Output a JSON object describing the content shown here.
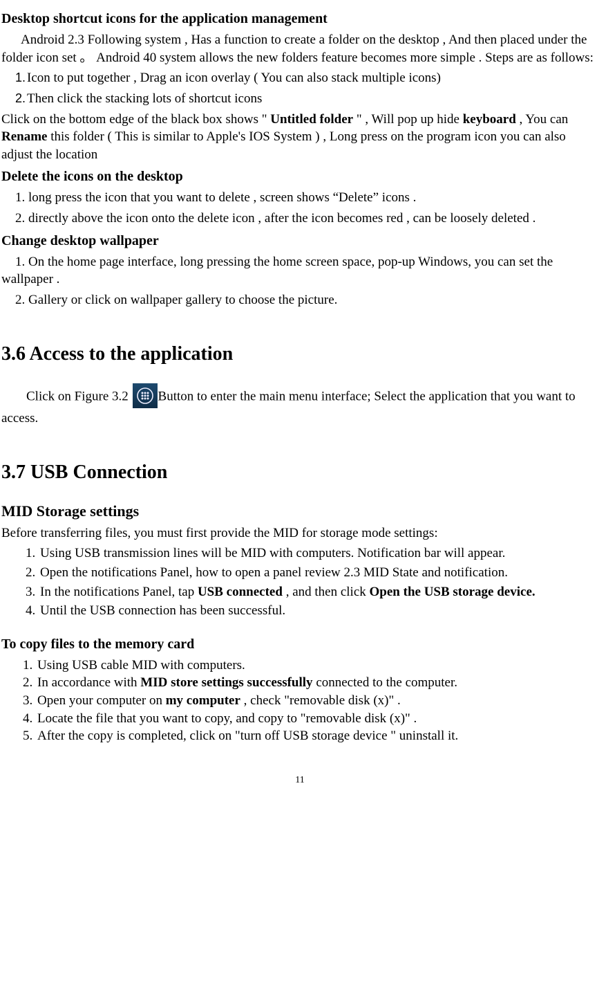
{
  "s1": {
    "title": "Desktop shortcut icons for the application management",
    "p1_a": "Android 2.3 Following system , Has a function to create a folder on the desktop , And then placed under the folder icon set  。  Android 40 system allows the new folders feature becomes more simple . Steps are as follows:",
    "li1_num": "1.",
    "li1": "Icon to put together , Drag an icon overlay ( You can also stack multiple icons)",
    "li2_num": "2.",
    "li2": "Then click the stacking lots of shortcut icons",
    "p2_a": "  Click on the bottom edge of the black box shows \" ",
    "p2_b": "Untitled folder",
    "p2_c": " \" , Will pop up hide ",
    "p2_d": "keyboard",
    "p2_e": " , You can ",
    "p2_f": "Rename",
    "p2_g": " this folder ( This is similar to Apple's IOS System ) , Long press on the program icon you can also adjust the location"
  },
  "s2": {
    "title": "Delete the icons on the desktop",
    "li1": "1. long press the icon that you want to delete , screen shows “Delete” icons .",
    "li2": "2. directly above the icon onto the delete icon , after the icon becomes red , can be loosely deleted ."
  },
  "s3": {
    "title": "Change desktop wallpaper",
    "li1": "1.  On the home page interface, long pressing the home screen space, pop-up Windows, you can set the wallpaper .",
    "li2": "2.  Gallery or click on wallpaper gallery to choose the picture."
  },
  "s4": {
    "title": "3.6 Access to the application",
    "p_pre": "Click on Figure 3.2  ",
    "p_post": "Button to enter the main menu interface; Select the application that you want to access.",
    "icon_name": "apps-grid-icon"
  },
  "s5": {
    "title": "3.7 USB Connection"
  },
  "s6": {
    "title": "MID Storage settings",
    "lead": "Before transferring files, you must first provide the MID for storage mode settings:",
    "li1": "Using USB transmission lines will be MID with computers. Notification bar will appear.",
    "li2": "Open the notifications Panel, how to open a panel review 2.3 MID State and notification.",
    "li3_a": "In the notifications Panel, tap ",
    "li3_b": "USB connected",
    "li3_c": " , and then click ",
    "li3_d": "Open the USB storage device.",
    "li4": "Until the USB connection has been successful."
  },
  "s7": {
    "title": "To copy files to the memory card",
    "li1": "Using USB cable MID with computers.",
    "li2_a": "In accordance with ",
    "li2_b": "MID store settings successfully",
    "li2_c": " connected to the computer.",
    "li3_a": "Open your computer on ",
    "li3_b": "my computer",
    "li3_c": " , check \"removable disk (x)\"  .",
    "li4": "Locate the file that you want to copy, and copy to \"removable disk (x)\"  .",
    "li5": "After the copy is completed, click on \"turn off USB storage device \" uninstall it."
  },
  "pagenum": "11"
}
